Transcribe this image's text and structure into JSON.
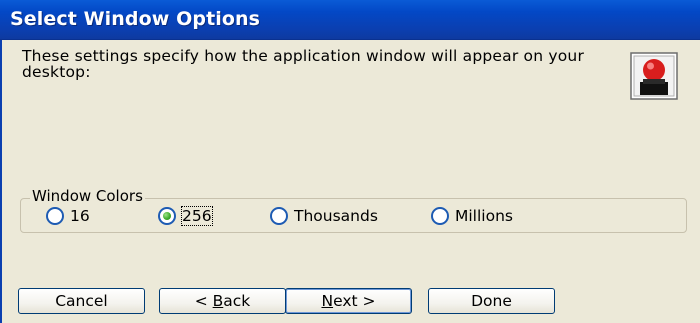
{
  "window": {
    "title": "Select Window Options"
  },
  "description": "These settings specify how the application window will appear on your desktop:",
  "icons": {
    "app": "app-window-options-icon"
  },
  "window_colors": {
    "group_label": "Window Colors",
    "options": [
      {
        "label": "16",
        "selected": false
      },
      {
        "label": "256",
        "selected": true
      },
      {
        "label": "Thousands",
        "selected": false
      },
      {
        "label": "Millions",
        "selected": false
      }
    ]
  },
  "buttons": {
    "cancel": {
      "label": "Cancel"
    },
    "back": {
      "prefix": "< ",
      "mnemonic": "B",
      "rest": "ack"
    },
    "next": {
      "mnemonic": "N",
      "rest": "ext",
      "suffix": " >"
    },
    "done": {
      "label": "Done"
    }
  },
  "colors": {
    "title_bar": "#0348c6",
    "window_bg": "#ece9d8",
    "button_border": "#003c74",
    "radio_selected": "#3fae2f"
  }
}
